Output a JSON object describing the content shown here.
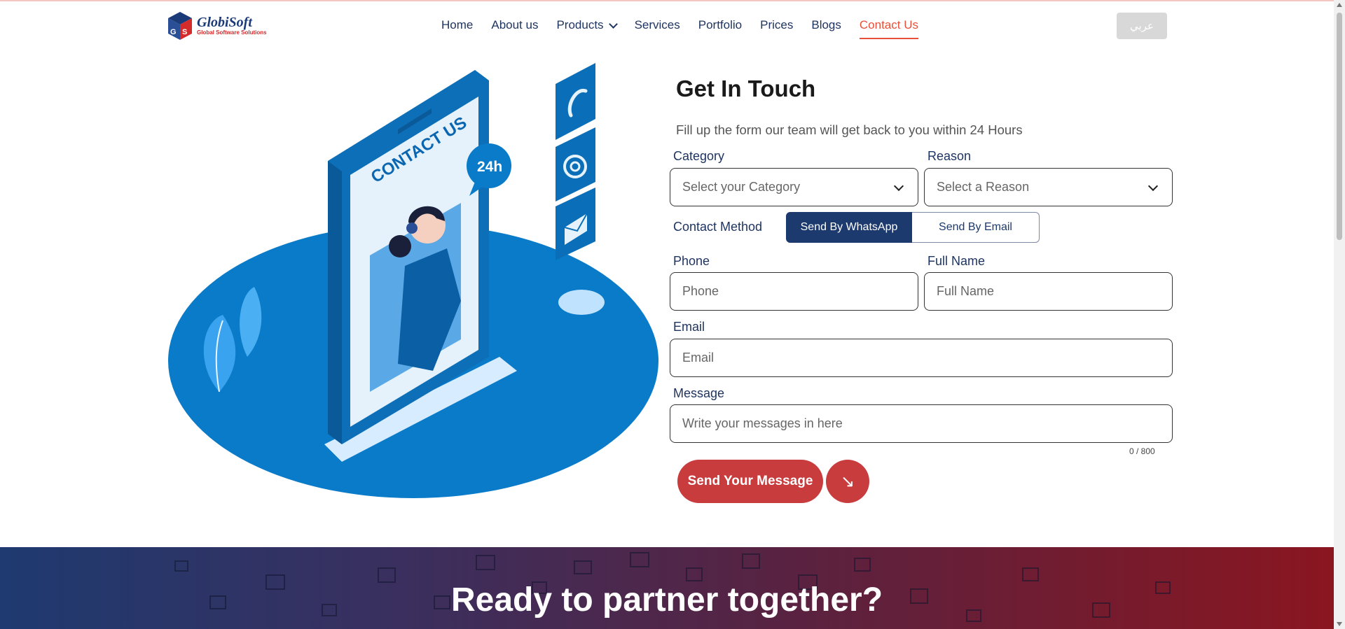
{
  "brand": {
    "name": "GlobiSoft",
    "tagline": "Global Software Solutions"
  },
  "nav": {
    "items": [
      {
        "label": "Home"
      },
      {
        "label": "About us"
      },
      {
        "label": "Products"
      },
      {
        "label": "Services"
      },
      {
        "label": "Portfolio"
      },
      {
        "label": "Prices"
      },
      {
        "label": "Blogs"
      },
      {
        "label": "Contact Us"
      }
    ],
    "active": "Contact Us",
    "language_button": "عربي"
  },
  "illustration": {
    "sign_text": "CONTACT US",
    "badge_text": "24h"
  },
  "form": {
    "title": "Get In Touch",
    "subtitle": "Fill up the form our team will get back to you within 24 Hours",
    "category": {
      "label": "Category",
      "placeholder": "Select your Category"
    },
    "reason": {
      "label": "Reason",
      "placeholder": "Select a Reason"
    },
    "contact_method": {
      "label": "Contact Method",
      "options": [
        "Send By WhatsApp",
        "Send By Email"
      ],
      "selected": "Send By WhatsApp"
    },
    "phone": {
      "label": "Phone",
      "placeholder": "Phone"
    },
    "full_name": {
      "label": "Full Name",
      "placeholder": "Full Name"
    },
    "email": {
      "label": "Email",
      "placeholder": "Email"
    },
    "message": {
      "label": "Message",
      "placeholder": "Write your messages in here",
      "counter": "0 / 800"
    },
    "submit_label": "Send Your Message",
    "submit_icon": "↘"
  },
  "banner": {
    "title": "Ready to partner together?"
  },
  "colors": {
    "navy": "#1c3a6e",
    "accent_red": "#c93c3e",
    "active_nav": "#e8503a",
    "illustration_blue": "#0a7bc8"
  }
}
